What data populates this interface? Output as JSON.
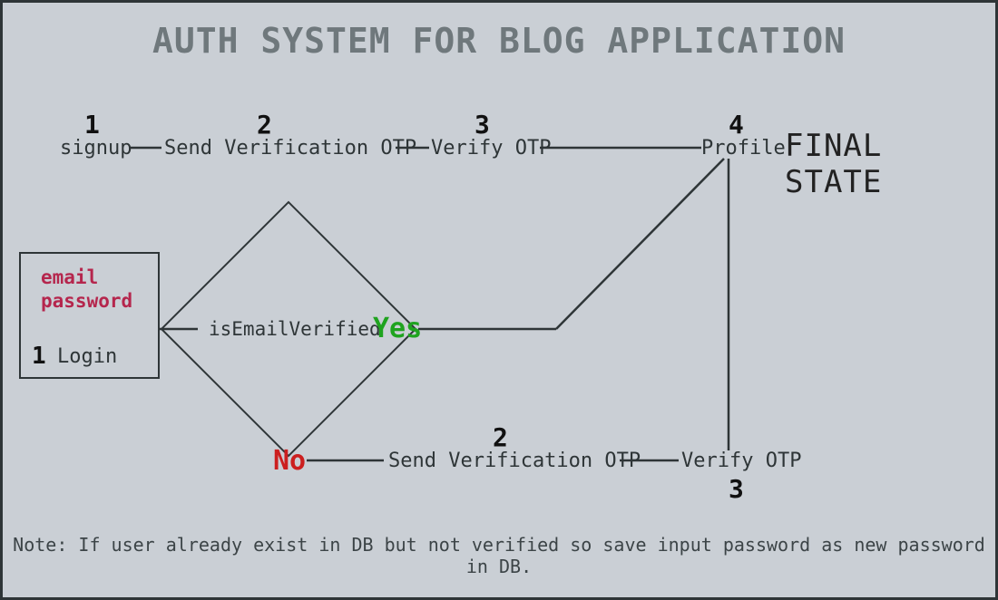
{
  "title": "AUTH SYSTEM FOR BLOG APPLICATION",
  "signup_flow": {
    "step1": {
      "num": "1",
      "label": "signup"
    },
    "step2": {
      "num": "2",
      "label": "Send Verification OTP"
    },
    "step3": {
      "num": "3",
      "label": "Verify OTP"
    },
    "step4": {
      "num": "4",
      "label": "Profile"
    }
  },
  "final_state_label": "FINAL STATE",
  "login_box": {
    "email": "email",
    "password": "password",
    "num": "1",
    "label": "Login"
  },
  "decision": {
    "label": "isEmailVerified",
    "yes": "Yes",
    "no": "No"
  },
  "no_flow": {
    "step2": {
      "num": "2",
      "label": "Send Verification OTP"
    },
    "step3": {
      "num": "3",
      "label": "Verify OTP"
    }
  },
  "note": "Note: If user already exist in DB but not verified so save input password as new password in DB."
}
